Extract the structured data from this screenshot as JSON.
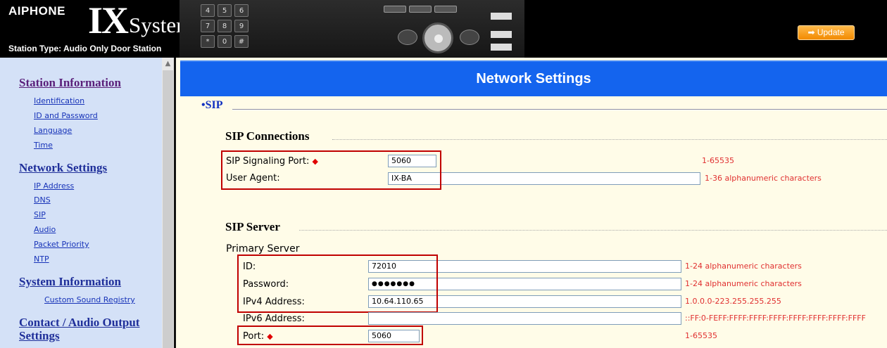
{
  "header": {
    "brand": "AIPHONE",
    "ix": "IX",
    "title": "System Setting",
    "station_type": "Station Type: Audio Only Door Station",
    "update_label": "➡ Update",
    "keypad": [
      "4",
      "5",
      "6",
      "7",
      "8",
      "9",
      "*",
      "0",
      "#"
    ]
  },
  "sidebar": {
    "station_information": "Station Information",
    "station_items": [
      "Identification",
      "ID and Password",
      "Language",
      "Time"
    ],
    "network_settings": "Network Settings",
    "network_items": [
      "IP Address",
      "DNS",
      "SIP",
      "Audio",
      "Packet Priority",
      "NTP"
    ],
    "system_information": "System Information",
    "system_items": [
      "Custom Sound Registry"
    ],
    "contact_line1": "Contact / Audio Output",
    "contact_line2": "Settings"
  },
  "main": {
    "title": "Network Settings",
    "section": "•SIP",
    "sip_connections": {
      "heading": "SIP Connections",
      "signaling_port_label": "SIP Signaling Port:",
      "signaling_port_value": "5060",
      "signaling_port_hint": "1-65535",
      "user_agent_label": "User Agent:",
      "user_agent_value": "IX-BA",
      "user_agent_hint": "1-36 alphanumeric characters"
    },
    "sip_server": {
      "heading": "SIP Server",
      "primary_label": "Primary Server",
      "id_label": "ID:",
      "id_value": "72010",
      "id_hint": "1-24 alphanumeric characters",
      "password_label": "Password:",
      "password_value": "●●●●●●●",
      "password_hint": "1-24 alphanumeric characters",
      "ipv4_label": "IPv4 Address:",
      "ipv4_value": "10.64.110.65",
      "ipv4_hint": "1.0.0.0-223.255.255.255",
      "ipv6_label": "IPv6 Address:",
      "ipv6_value": "",
      "ipv6_hint": "::FF:0-FEFF:FFFF:FFFF:FFFF:FFFF:FFFF:FFFF:FFFF",
      "port_label": "Port:",
      "port_value": "5060",
      "port_hint": "1-65535"
    },
    "required_mark": "◆"
  },
  "colors": {
    "title_bar": "#1464ee",
    "sidebar_bg": "#d4e1f7",
    "main_bg": "#fffce8",
    "highlight_box": "#c00000",
    "hint": "#e03030"
  }
}
